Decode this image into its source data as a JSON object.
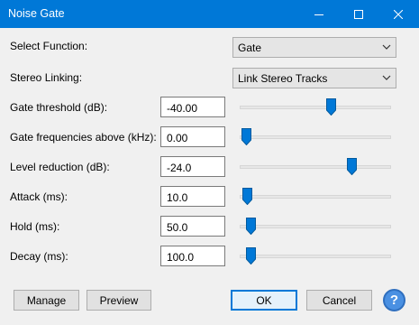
{
  "window": {
    "title": "Noise Gate"
  },
  "controls": {
    "select_function": {
      "label": "Select Function:",
      "value": "Gate"
    },
    "stereo_linking": {
      "label": "Stereo Linking:",
      "value": "Link Stereo Tracks"
    },
    "gate_threshold": {
      "label": "Gate threshold (dB):",
      "value": "-40.00",
      "slider_fraction": 0.6
    },
    "gate_frequencies": {
      "label": "Gate frequencies above (kHz):",
      "value": "0.00",
      "slider_fraction": 0.04
    },
    "level_reduction": {
      "label": "Level reduction (dB):",
      "value": "-24.0",
      "slider_fraction": 0.74
    },
    "attack": {
      "label": "Attack (ms):",
      "value": "10.0",
      "slider_fraction": 0.05
    },
    "hold": {
      "label": "Hold (ms):",
      "value": "50.0",
      "slider_fraction": 0.07
    },
    "decay": {
      "label": "Decay (ms):",
      "value": "100.0",
      "slider_fraction": 0.07
    }
  },
  "buttons": {
    "manage": "Manage",
    "preview": "Preview",
    "ok": "OK",
    "cancel": "Cancel",
    "help": "?"
  },
  "colors": {
    "titlebar": "#0078d7",
    "slider_thumb": "#0078d7"
  },
  "icons": {
    "minimize": "minimize-icon",
    "maximize": "maximize-icon",
    "close": "close-icon",
    "dropdown": "chevron-down-icon",
    "help": "help-icon"
  }
}
